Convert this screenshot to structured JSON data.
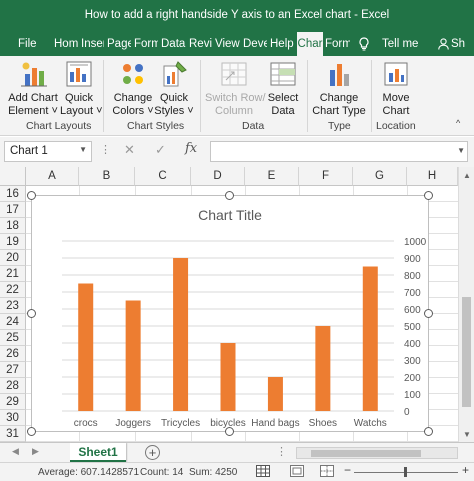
{
  "window": {
    "title": "How to add a right handside Y axis to an Excel chart  -  Excel"
  },
  "tabs": [
    {
      "label": "File",
      "active": false
    },
    {
      "label": "Hom",
      "active": false
    },
    {
      "label": "Inser",
      "active": false
    },
    {
      "label": "Page",
      "active": false
    },
    {
      "label": "Form",
      "active": false
    },
    {
      "label": "Data",
      "active": false
    },
    {
      "label": "Revie",
      "active": false
    },
    {
      "label": "View",
      "active": false
    },
    {
      "label": "Deve",
      "active": false
    },
    {
      "label": "Help",
      "active": false
    },
    {
      "label": "Char",
      "active": true
    },
    {
      "label": "Form",
      "active": false
    },
    {
      "label": "Tell me",
      "active": false
    },
    {
      "label": "Sh",
      "active": false
    }
  ],
  "ribbon": {
    "add_chart_element": {
      "line1": "Add Chart",
      "line2": "Element ˅"
    },
    "quick_layout": {
      "line1": "Quick",
      "line2": "Layout ˅"
    },
    "change_colors": {
      "line1": "Change",
      "line2": "Colors ˅"
    },
    "quick_styles": {
      "line1": "Quick",
      "line2": "Styles ˅"
    },
    "switch_row_column": {
      "line1": "Switch Row/",
      "line2": "Column"
    },
    "select_data": {
      "line1": "Select",
      "line2": "Data"
    },
    "change_chart_type": {
      "line1": "Change",
      "line2": "Chart Type"
    },
    "move_chart": {
      "line1": "Move",
      "line2": "Chart"
    },
    "groups": {
      "chart_layouts": "Chart Layouts",
      "chart_styles": "Chart Styles",
      "data": "Data",
      "type": "Type",
      "location": "Location"
    }
  },
  "formula_bar": {
    "name_box": "Chart 1",
    "formula": "",
    "fx": "fx"
  },
  "columns": [
    "A",
    "B",
    "C",
    "D",
    "E",
    "F",
    "G",
    "H"
  ],
  "rows": [
    "16",
    "17",
    "18",
    "19",
    "20",
    "21",
    "22",
    "23",
    "24",
    "25",
    "26",
    "27",
    "28",
    "29",
    "30",
    "31"
  ],
  "accent_color": "#ED7D31",
  "brand_color": "#217346",
  "chart_data": {
    "type": "bar",
    "title": "Chart Title",
    "categories": [
      "crocs",
      "Joggers",
      "Tricycles",
      "bicycles",
      "Hand bags",
      "Shoes",
      "Watchs"
    ],
    "values": [
      750,
      650,
      900,
      400,
      200,
      500,
      850
    ],
    "y_axis_position": "right",
    "ylim": [
      0,
      1000
    ],
    "yticks": [
      0,
      100,
      200,
      300,
      400,
      500,
      600,
      700,
      800,
      900,
      1000
    ],
    "grid": true,
    "color": "#ED7D31"
  },
  "sheets": {
    "active": "Sheet1"
  },
  "status": {
    "average": "Average: 607.1428571",
    "count": "Count: 14",
    "sum": "Sum: 4250"
  }
}
